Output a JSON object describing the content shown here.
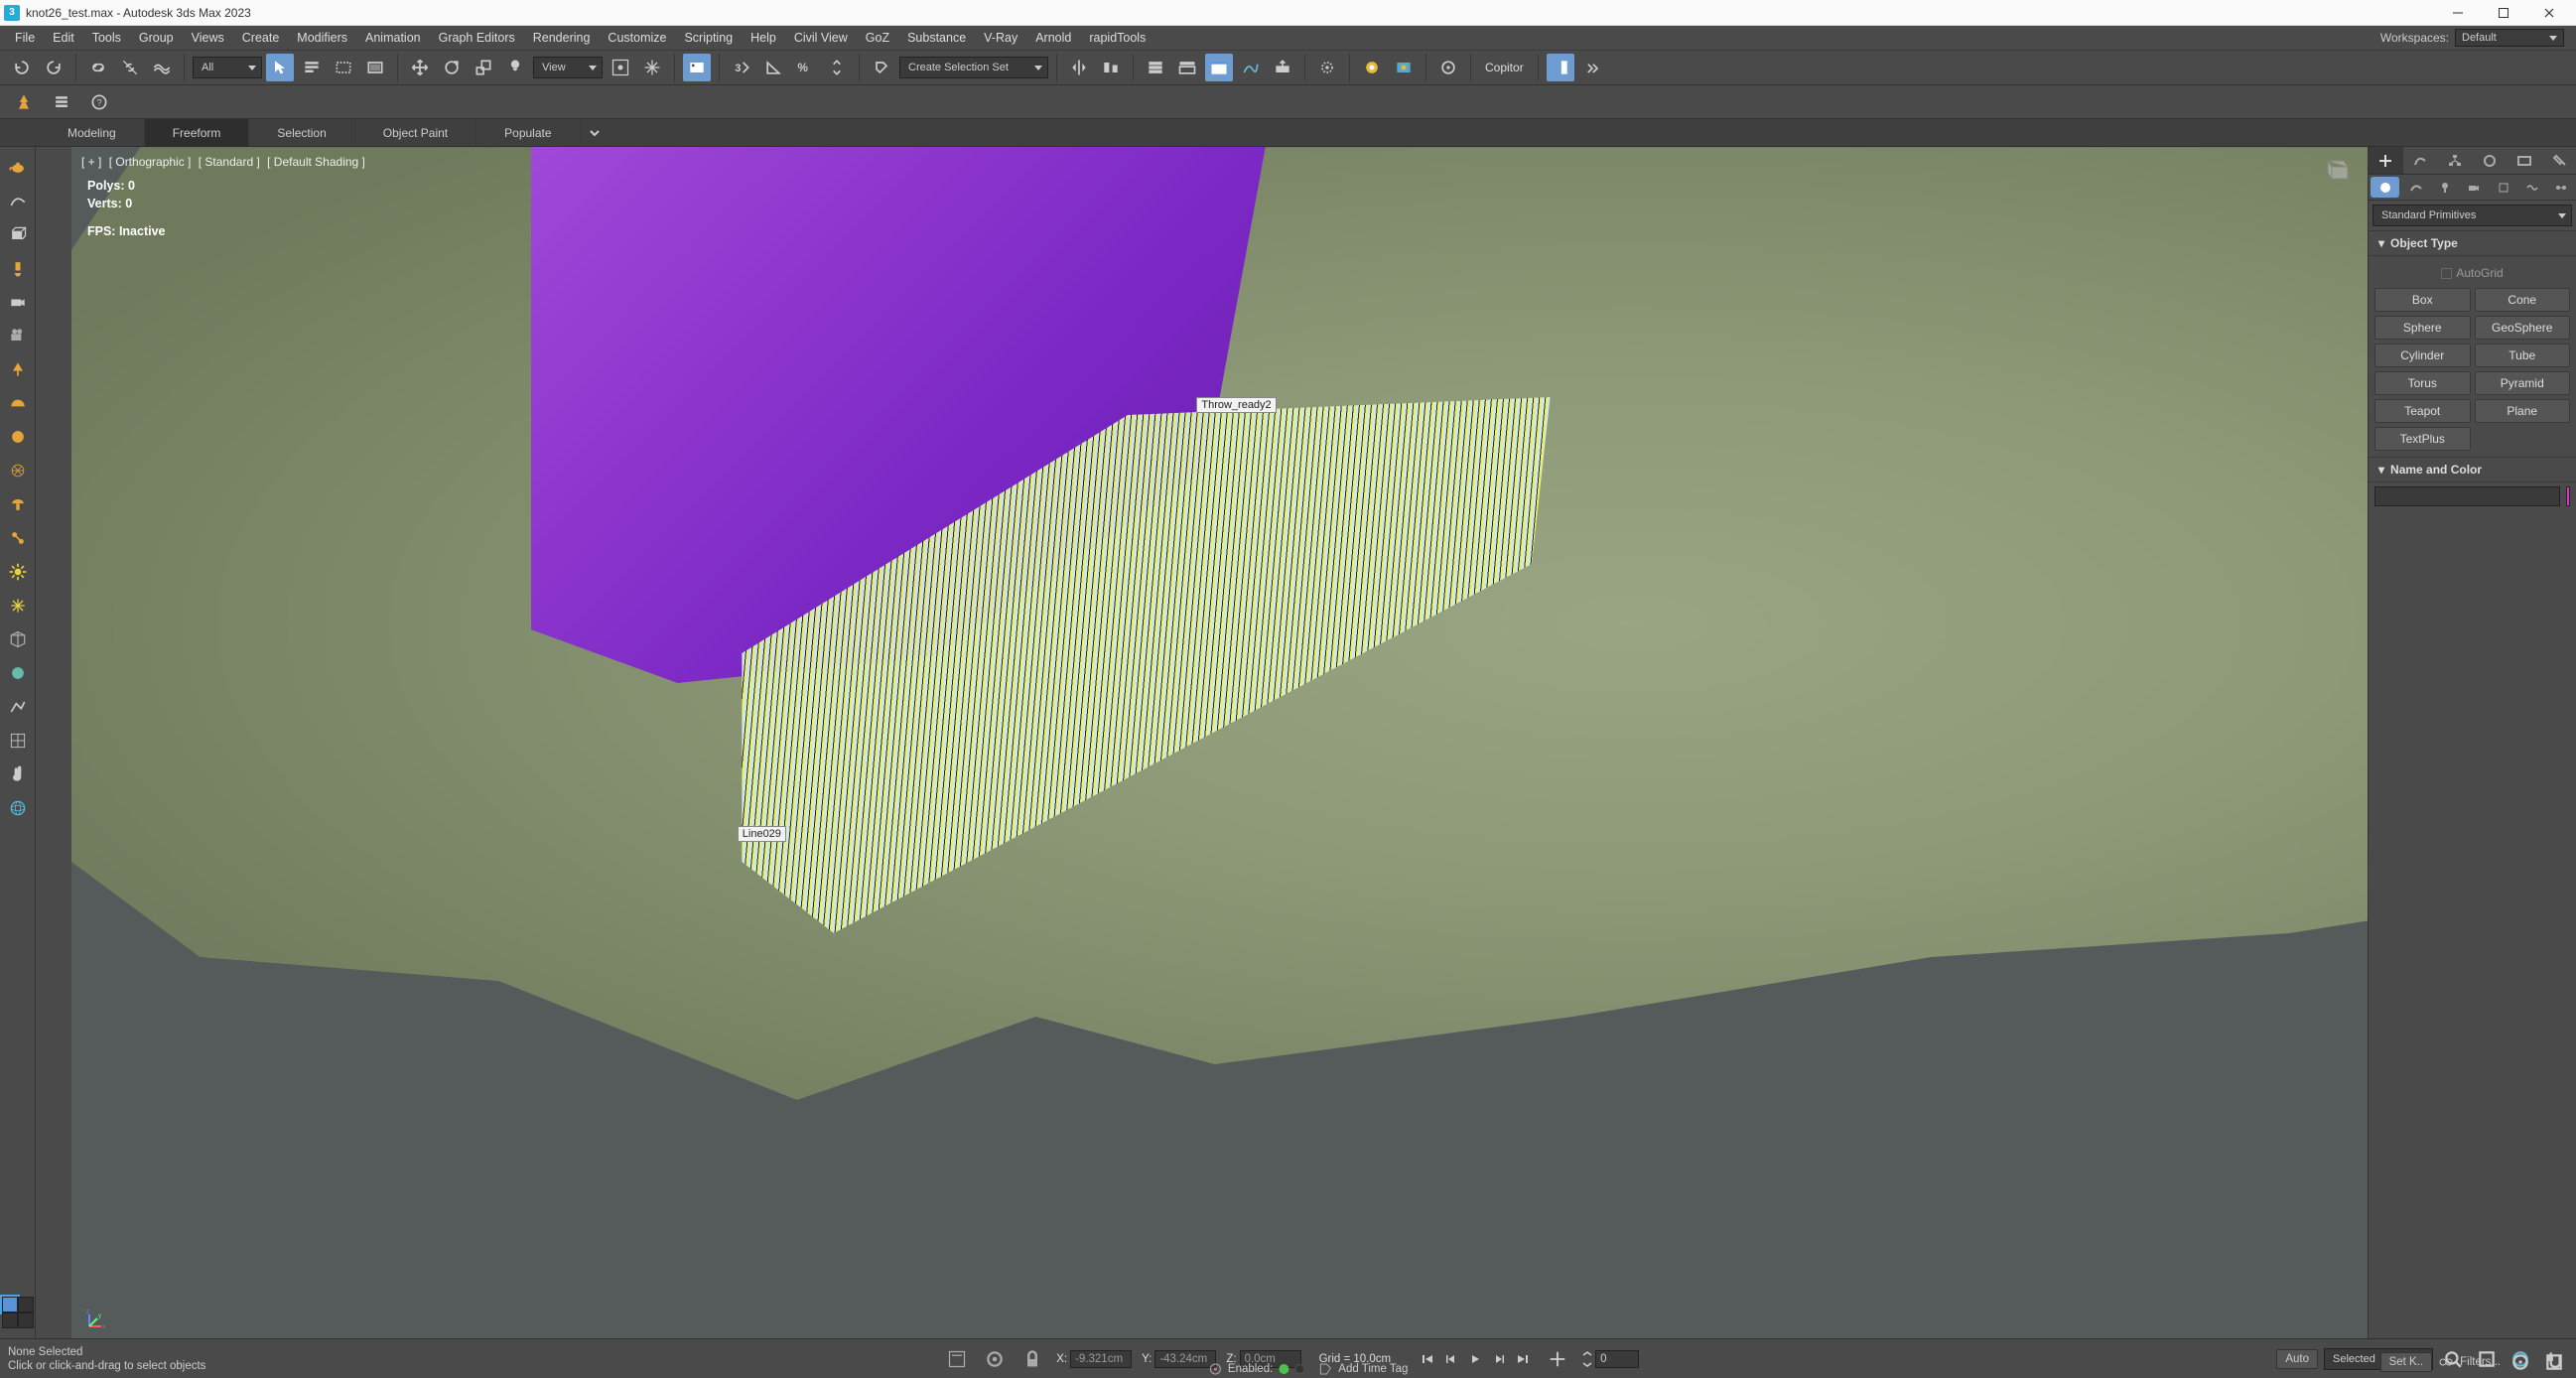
{
  "titlebar": {
    "title": "knot26_test.max - Autodesk 3ds Max 2023"
  },
  "menubar": {
    "items": [
      "File",
      "Edit",
      "Tools",
      "Group",
      "Views",
      "Create",
      "Modifiers",
      "Animation",
      "Graph Editors",
      "Rendering",
      "Customize",
      "Scripting",
      "Help",
      "Civil View",
      "GoZ",
      "Substance",
      "V-Ray",
      "Arnold",
      "rapidTools"
    ],
    "workspaces_label": "Workspaces:",
    "workspaces_value": "Default"
  },
  "toolbar": {
    "all_dd": "All",
    "view_dd": "View",
    "selset_dd": "Create Selection Set",
    "copitor": "Copitor"
  },
  "ribbon": {
    "tabs": [
      "Modeling",
      "Freeform",
      "Selection",
      "Object Paint",
      "Populate"
    ],
    "active": 1
  },
  "viewport": {
    "labels": [
      "[ + ]",
      "[ Orthographic ]",
      "[ Standard ]",
      "[ Default Shading ]"
    ],
    "stats": {
      "polys": "Polys:  0",
      "verts": "Verts:  0",
      "fps": "FPS:    Inactive"
    },
    "tag1": "Throw_ready2",
    "tag2": "Line029"
  },
  "cmdpanel": {
    "category_dd": "Standard Primitives",
    "objtype_h": "Object Type",
    "autogrid": "AutoGrid",
    "primitives": [
      "Box",
      "Cone",
      "Sphere",
      "GeoSphere",
      "Cylinder",
      "Tube",
      "Torus",
      "Pyramid",
      "Teapot",
      "Plane",
      "TextPlus"
    ],
    "nameclr_h": "Name and Color",
    "name_value": ""
  },
  "status": {
    "line1": "None Selected",
    "line2": "Click or click-and-drag to select objects",
    "enabled": "Enabled:",
    "addtag": "Add Time Tag",
    "x_lbl": "X:",
    "x_val": "-9.321cm",
    "y_lbl": "Y:",
    "y_val": "-43.24cm",
    "z_lbl": "Z:",
    "z_val": "0.0cm",
    "grid": "Grid = 10.0cm",
    "frame": "0",
    "auto": "Auto",
    "setk": "Set K..",
    "selected_dd": "Selected",
    "filters": "Filters..."
  }
}
